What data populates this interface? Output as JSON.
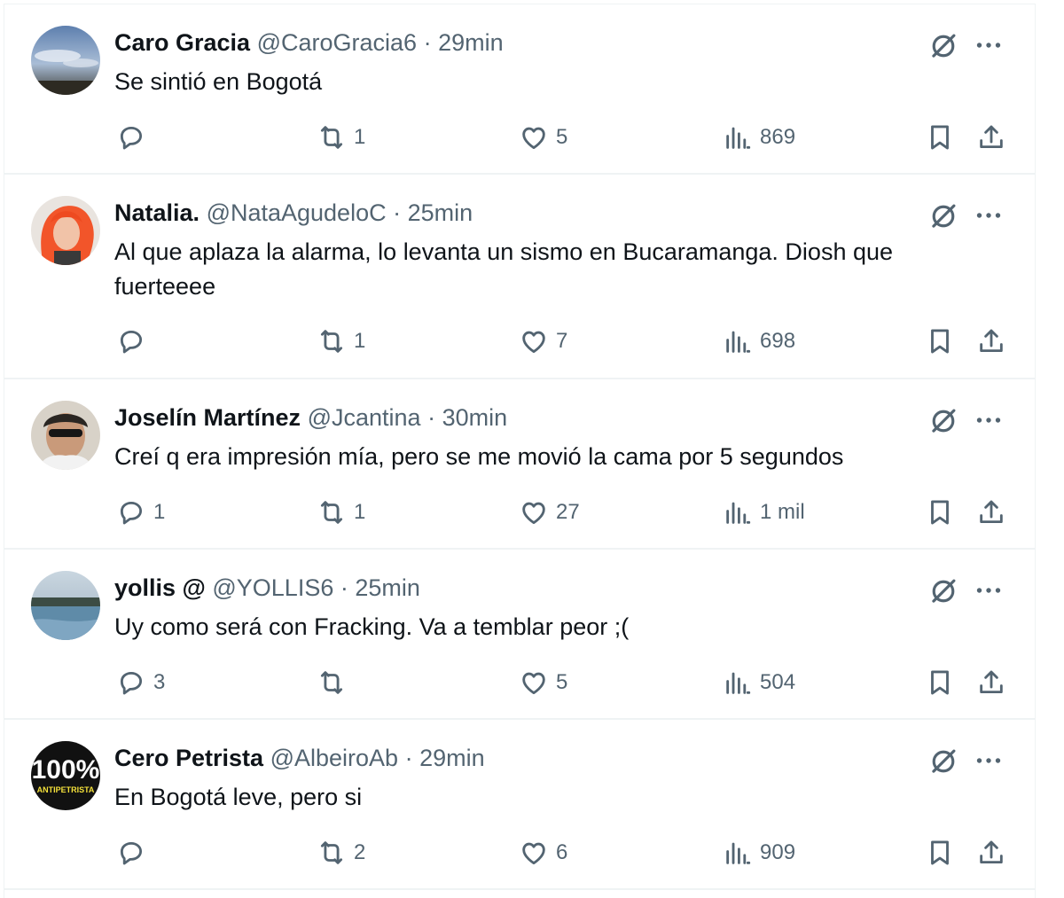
{
  "tweets": [
    {
      "name": "Caro Gracia",
      "handle": "@CaroGracia6",
      "separator": "·",
      "time": "29min",
      "text": "Se sintió en Bogotá",
      "replies": "",
      "retweets": "1",
      "likes": "5",
      "views": "869"
    },
    {
      "name": "Natalia.",
      "handle": "@NataAgudeloC",
      "separator": "·",
      "time": "25min",
      "text": "Al que aplaza la alarma, lo levanta un sismo en Bucaramanga. Diosh que fuerteeee",
      "replies": "",
      "retweets": "1",
      "likes": "7",
      "views": "698"
    },
    {
      "name": "Joselín Martínez",
      "handle": "@Jcantina",
      "separator": "·",
      "time": "30min",
      "text": "Creí q era impresión mía, pero se me movió la cama por 5 segundos",
      "replies": "1",
      "retweets": "1",
      "likes": "27",
      "views": "1 mil"
    },
    {
      "name": "yollis @",
      "handle": "@YOLLIS6",
      "separator": "·",
      "time": "25min",
      "text": "Uy como será con Fracking. Va a temblar peor ;(",
      "replies": "3",
      "retweets": "",
      "likes": "5",
      "views": "504"
    },
    {
      "name": "Cero Petrista",
      "handle": "@AlbeiroAb",
      "separator": "·",
      "time": "29min",
      "text": "En Bogotá leve, pero si",
      "replies": "",
      "retweets": "2",
      "likes": "6",
      "views": "909",
      "avatar_text_big": "100%",
      "avatar_text_small": "ANTIPETRISTA"
    }
  ],
  "icons": {
    "reply": "reply-icon",
    "retweet": "retweet-icon",
    "like": "like-icon",
    "views": "views-icon",
    "bookmark": "bookmark-icon",
    "share": "share-icon",
    "grok": "grok-icon",
    "more": "more-icon"
  },
  "colors": {
    "text": "#0f1419",
    "secondary": "#536471",
    "divider": "#eff3f4"
  }
}
